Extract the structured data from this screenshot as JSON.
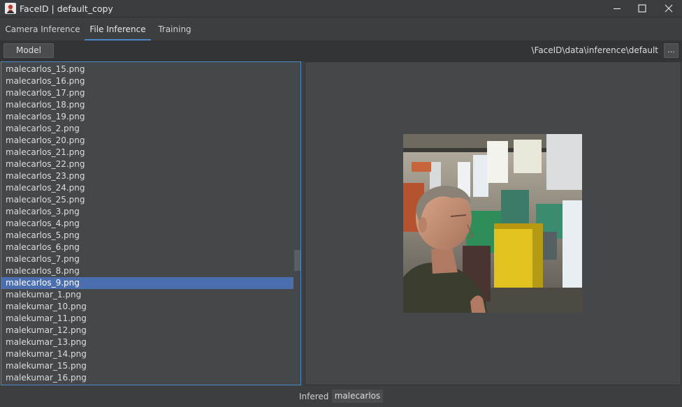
{
  "window": {
    "title": "FaceID | default_copy",
    "app_icon": "faceid-app-icon",
    "controls": [
      "minimize-icon",
      "maximize-icon",
      "close-icon"
    ]
  },
  "tabs": [
    {
      "label": "Camera Inference",
      "active": false
    },
    {
      "label": "File Inference",
      "active": true
    },
    {
      "label": "Training",
      "active": false
    }
  ],
  "toolbar": {
    "model_label": "Model",
    "path": "\\FaceID\\data\\inference\\default",
    "browse_label": "..."
  },
  "file_list": {
    "items": [
      "malecarlos_15.png",
      "malecarlos_16.png",
      "malecarlos_17.png",
      "malecarlos_18.png",
      "malecarlos_19.png",
      "malecarlos_2.png",
      "malecarlos_20.png",
      "malecarlos_21.png",
      "malecarlos_22.png",
      "malecarlos_23.png",
      "malecarlos_24.png",
      "malecarlos_25.png",
      "malecarlos_3.png",
      "malecarlos_4.png",
      "malecarlos_5.png",
      "malecarlos_6.png",
      "malecarlos_7.png",
      "malecarlos_8.png",
      "malecarlos_9.png",
      "malekumar_1.png",
      "malekumar_10.png",
      "malekumar_11.png",
      "malekumar_12.png",
      "malekumar_13.png",
      "malekumar_14.png",
      "malekumar_15.png",
      "malekumar_16.png"
    ],
    "selected": "malecarlos_9.png"
  },
  "status": {
    "label": "Infered",
    "value": "malecarlos"
  },
  "colors": {
    "accent": "#4a88c7",
    "selection": "#4b6eaf",
    "panel": "#45484b",
    "background": "#3c3f41"
  }
}
